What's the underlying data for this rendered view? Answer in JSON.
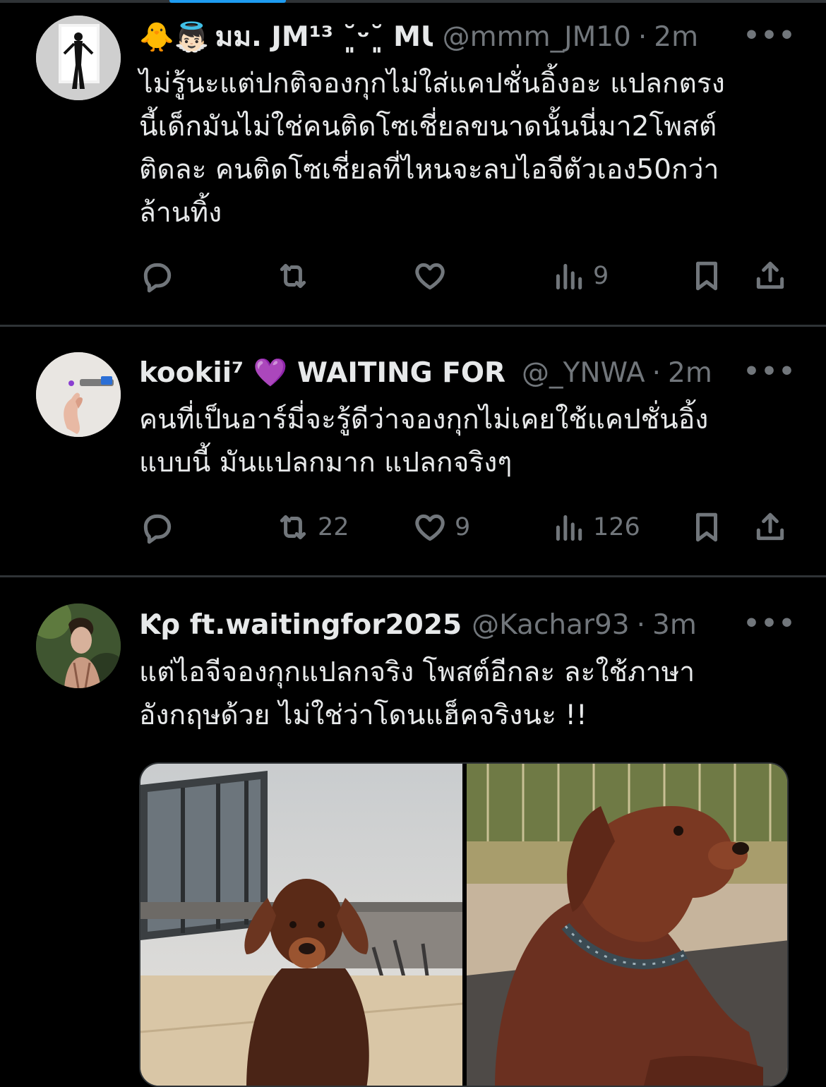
{
  "tweets": [
    {
      "emoji": "🐥👼🏻",
      "name": "มม. JM¹³ ˘͈ᵕ˘͈ MU",
      "handle": "@mmm_JM10",
      "time": "2m",
      "text": "ไม่รู้นะแต่ปกติจองกุกไม่ใส่แคปชั่นอิ้งอะ แปลกตรง\nนี้เด็กมันไม่ใช่คนติดโซเชี่ยลขนาดนั้นนี่มา2โพสต์\nติดละ คนติดโซเชี่ยลที่ไหนจะลบไอจีตัวเอง50กว่า\nล้านทิ้ง",
      "retweets": "",
      "likes": "",
      "views": "9"
    },
    {
      "name": "kookii⁷ 💜 WAITING FOR :",
      "handle": "@_YNWA",
      "time": "2m",
      "text": "คนที่เป็นอาร์มี่จะรู้ดีว่าจองกุกไม่เคยใช้แคปชั่นอิ้ง\nแบบนี้ มันแปลกมาก แปลกจริงๆ",
      "retweets": "22",
      "likes": "9",
      "views": "126"
    },
    {
      "name": "Ƙρ ft.waitingfor2025",
      "handle": "@Kachar93",
      "time": "3m",
      "text": "แต่ไอจีจองกุกแปลกจริง โพสต์อีกละ ละใช้ภาษา\nอังกฤษด้วย ไม่ใช่ว่าโดนแฮ็คจริงนะ !!"
    }
  ],
  "more_glyph": "•••",
  "colors": {
    "background": "#000000",
    "text": "#e7e9ea",
    "muted": "#71767b",
    "divider": "#2f3336",
    "heart": "#a98ee0"
  }
}
